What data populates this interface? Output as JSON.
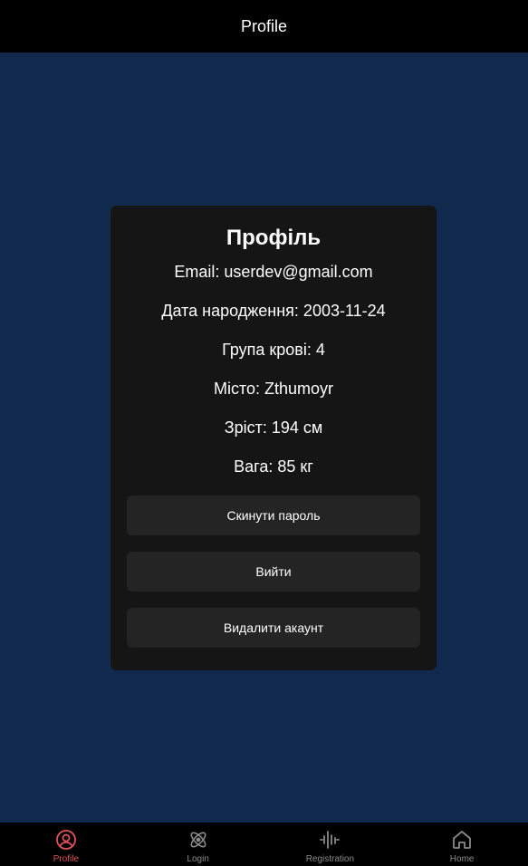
{
  "header": {
    "title": "Profile"
  },
  "profile": {
    "title": "Профіль",
    "email": "Email: userdev@gmail.com",
    "birthdate": "Дата народження: 2003-11-24",
    "blood_group": "Група крові: 4",
    "city": "Місто: Zthumoyr",
    "height": "Зріст: 194 см",
    "weight": "Вага: 85 кг"
  },
  "actions": {
    "reset_password": "Скинути пароль",
    "logout": "Вийти",
    "delete_account": "Видалити акаунт"
  },
  "nav": {
    "active_color": "#e0525a",
    "inactive_color": "#8a8a8a",
    "items": [
      {
        "label": "Profile",
        "icon": "user-circle-icon",
        "active": true
      },
      {
        "label": "Login",
        "icon": "atom-icon",
        "active": false
      },
      {
        "label": "Registration",
        "icon": "waveform-icon",
        "active": false
      },
      {
        "label": "Home",
        "icon": "home-icon",
        "active": false
      }
    ]
  }
}
